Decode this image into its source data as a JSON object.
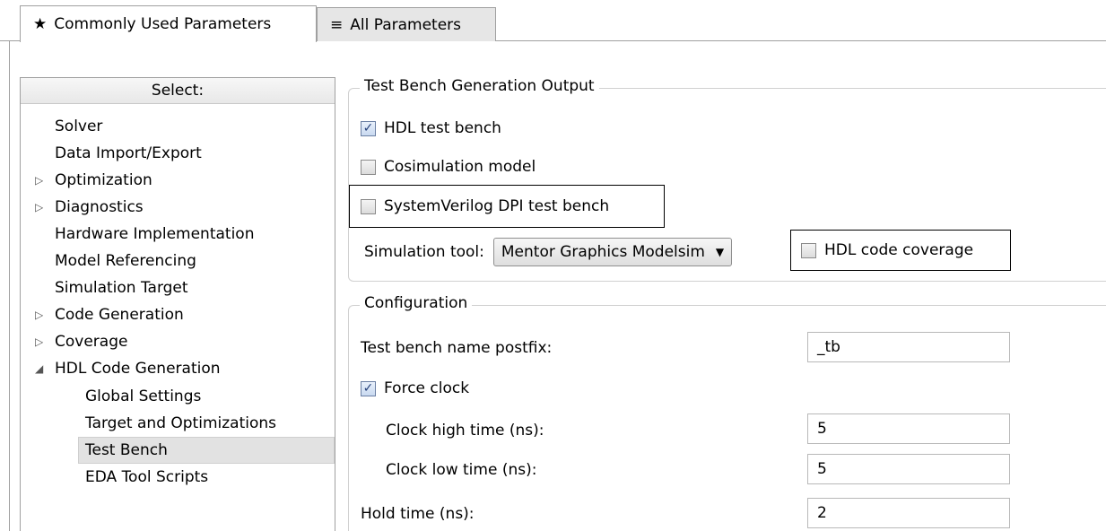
{
  "tabs": [
    {
      "label": "Commonly Used Parameters",
      "glyph": "★",
      "icon": "star-icon",
      "active": true
    },
    {
      "label": "All Parameters",
      "glyph": "≡",
      "icon": "list-icon",
      "active": false
    }
  ],
  "tree": {
    "header": "Select:",
    "items": [
      {
        "label": "Solver",
        "expander": ""
      },
      {
        "label": "Data Import/Export",
        "expander": ""
      },
      {
        "label": "Optimization",
        "expander": "▷"
      },
      {
        "label": "Diagnostics",
        "expander": "▷"
      },
      {
        "label": "Hardware Implementation",
        "expander": ""
      },
      {
        "label": "Model Referencing",
        "expander": ""
      },
      {
        "label": "Simulation Target",
        "expander": ""
      },
      {
        "label": "Code Generation",
        "expander": "▷"
      },
      {
        "label": "Coverage",
        "expander": "▷"
      },
      {
        "label": "HDL Code Generation",
        "expander": "◢"
      },
      {
        "label": "Global Settings",
        "expander": ""
      },
      {
        "label": "Target and Optimizations",
        "expander": ""
      },
      {
        "label": "Test Bench",
        "expander": "",
        "selected": true
      },
      {
        "label": "EDA Tool Scripts",
        "expander": ""
      }
    ]
  },
  "output_group": {
    "title": "Test Bench Generation Output",
    "hdl_test_bench": {
      "label": "HDL test bench",
      "checked": true
    },
    "cosimulation_model": {
      "label": "Cosimulation model",
      "checked": false
    },
    "systemverilog_dpi": {
      "label": "SystemVerilog DPI test bench",
      "checked": false
    },
    "simulation_tool_label": "Simulation tool:",
    "simulation_tool_value": "Mentor Graphics Modelsim",
    "hdl_code_coverage": {
      "label": "HDL code coverage",
      "checked": false
    }
  },
  "config_group": {
    "title": "Configuration",
    "postfix_label": "Test bench name postfix:",
    "postfix_value": "_tb",
    "force_clock": {
      "label": "Force clock",
      "checked": true
    },
    "clock_high_label": "Clock high time (ns):",
    "clock_high_value": "5",
    "clock_low_label": "Clock low time (ns):",
    "clock_low_value": "5",
    "hold_time_label": "Hold time (ns):",
    "hold_time_value": "2"
  },
  "checkmark": "✓",
  "dropdown_caret": "▼"
}
